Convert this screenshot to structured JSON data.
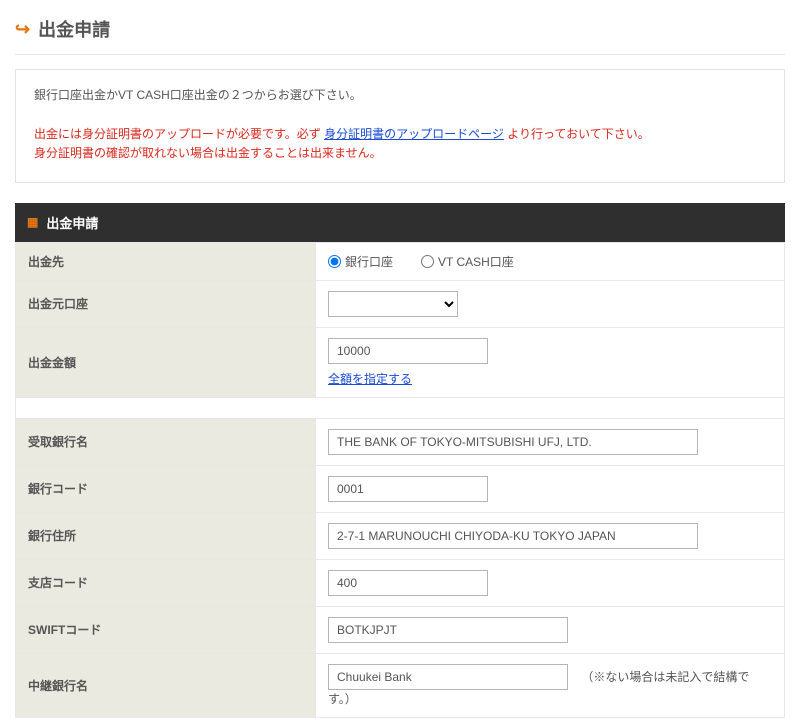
{
  "page": {
    "title": "出金申請"
  },
  "intro": {
    "text": "銀行口座出金かVT CASH口座出金の２つからお選び下さい。",
    "warning_before_link": "出金には身分証明書のアップロードが必要です。必ず",
    "warning_link": "身分証明書のアップロードページ",
    "warning_after_link": "より行っておいて下さい。",
    "warning_line2": "身分証明書の確認が取れない場合は出金することは出来ません。"
  },
  "section_header": "出金申請",
  "fields": {
    "destination": {
      "label": "出金先"
    },
    "radio_bank": "銀行口座",
    "radio_vtcash": "VT CASH口座",
    "source_account": {
      "label": "出金元口座"
    },
    "amount": {
      "label": "出金金額",
      "value": "10000",
      "link": "全額を指定する"
    },
    "bank_name": {
      "label": "受取銀行名",
      "value": "THE BANK OF TOKYO-MITSUBISHI UFJ, LTD."
    },
    "bank_code": {
      "label": "銀行コード",
      "value": "0001"
    },
    "bank_address": {
      "label": "銀行住所",
      "value": "2-7-1 MARUNOUCHI CHIYODA-KU TOKYO JAPAN"
    },
    "branch_code": {
      "label": "支店コード",
      "value": "400"
    },
    "swift": {
      "label": "SWIFTコード",
      "value": "BOTKJPJT"
    },
    "relay_bank": {
      "label": "中継銀行名",
      "value": "Chuukei Bank",
      "note": "（※ない場合は未記入で結構です。）"
    }
  }
}
